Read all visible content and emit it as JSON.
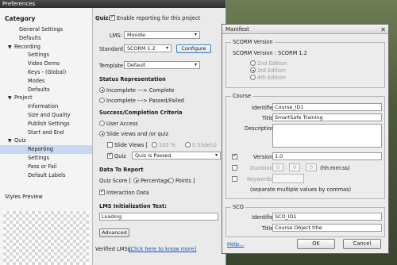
{
  "window": {
    "title": "Preferences"
  },
  "left": {
    "category_title": "Category",
    "tree": [
      {
        "label": "General Settings",
        "level": 1
      },
      {
        "label": "Defaults",
        "level": 1
      },
      {
        "label": "Recording",
        "level": 0,
        "arrow": "▼"
      },
      {
        "label": "Settings",
        "level": 2
      },
      {
        "label": "Video Demo",
        "level": 2
      },
      {
        "label": "Keys - (Global)",
        "level": 2
      },
      {
        "label": "Modes",
        "level": 2
      },
      {
        "label": "Defaults",
        "level": 2
      },
      {
        "label": "Project",
        "level": 0,
        "arrow": "▼"
      },
      {
        "label": "Information",
        "level": 2
      },
      {
        "label": "Size and Quality",
        "level": 2
      },
      {
        "label": "Publish Settings",
        "level": 2
      },
      {
        "label": "Start and End",
        "level": 2
      },
      {
        "label": "Quiz",
        "level": 0,
        "arrow": "▼"
      },
      {
        "label": "Reporting",
        "level": 2,
        "selected": true
      },
      {
        "label": "Settings",
        "level": 2
      },
      {
        "label": "Pass or Fail",
        "level": 2
      },
      {
        "label": "Default Labels",
        "level": 2
      }
    ],
    "styles_preview": "Styles Preview"
  },
  "main": {
    "quiz_label": "Quiz:",
    "enable_reporting": "Enable reporting for this project",
    "lms_label": "LMS:",
    "lms_value": "Moodle",
    "standard_label": "Standard:",
    "standard_value": "SCORM 1.2",
    "configure": "Configure",
    "template_label": "Template:",
    "template_value": "Default",
    "status_heading": "Status Representation",
    "status_opt1": "Incomplete ---> Complete",
    "status_opt2": "Incomplete ---> Passed/Failed",
    "criteria_heading": "Success/Completion Criteria",
    "user_access": "User Access",
    "slide_views_quiz": "Slide views and /or quiz",
    "slide_views": "Slide Views [",
    "pct_100": "100 %",
    "slides_0": "0 Slide(s)",
    "quiz_cb": "Quiz",
    "quiz_value": "Quiz is Passed",
    "data_heading": "Data To Report",
    "quiz_score": "Quiz Score  [",
    "percentage": "Percentage",
    "points": "Points ]",
    "interaction_data": "Interaction Data",
    "lms_init_heading": "LMS Initialization Text:",
    "lms_init_value": "Loading",
    "advanced": "Advanced",
    "verified_label": "Verified LMSs:",
    "verified_link": "[Click here to know more]"
  },
  "manifest": {
    "title": "Manifest",
    "close": "✕",
    "scorm_group": "SCORM Version",
    "scorm_version": "SCORM Version : SCORM 1.2",
    "ed2": "2nd Edition",
    "ed3": "3rd Edition",
    "ed4": "4th Edition",
    "course_group": "Course",
    "identifier_label": "Identifier:",
    "identifier_value": "Course_ID1",
    "title_label": "Title:",
    "title_value": "SmartSafe Training",
    "description_label": "Description:",
    "version_label": "Version:",
    "version_value": "1.0",
    "duration_label": "Duration:",
    "dur_h": "0",
    "dur_m": "0",
    "dur_s": "0",
    "dur_fmt": "(hh:mm:ss)",
    "keywords_label": "Keywords:",
    "keywords_note": "(separate multiple values by commas)",
    "sco_group": "SCO",
    "sco_identifier_label": "Identifier:",
    "sco_identifier_value": "SCO_ID1",
    "sco_title_label": "Title:",
    "sco_title_value": "Course Object title",
    "help": "Help...",
    "ok": "OK",
    "cancel": "Cancel"
  }
}
